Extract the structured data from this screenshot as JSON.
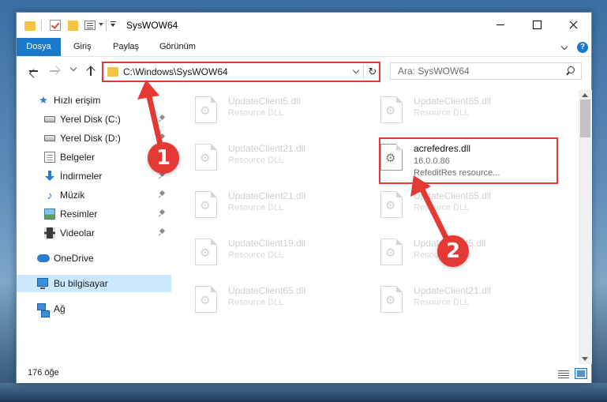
{
  "window": {
    "title": "SysWOW64"
  },
  "ribbon": {
    "tabs": [
      "Dosya",
      "Giriş",
      "Paylaş",
      "Görünüm"
    ],
    "help_icon": "?"
  },
  "nav": {
    "address": "C:\\Windows\\SysWOW64",
    "search_placeholder": "Ara: SysWOW64"
  },
  "sidebar": {
    "items": [
      {
        "label": "Hızlı erişim",
        "icon": "star-icon"
      },
      {
        "label": "Yerel Disk (C:)",
        "icon": "disk-icon",
        "pinned": true
      },
      {
        "label": "Yerel Disk (D:)",
        "icon": "disk-icon",
        "pinned": true
      },
      {
        "label": "Belgeler",
        "icon": "documents-icon",
        "pinned": true
      },
      {
        "label": "İndirmeler",
        "icon": "download-icon",
        "pinned": true
      },
      {
        "label": "Müzik",
        "icon": "music-icon",
        "pinned": true
      },
      {
        "label": "Resimler",
        "icon": "pictures-icon",
        "pinned": true
      },
      {
        "label": "Videolar",
        "icon": "videos-icon",
        "pinned": true
      },
      {
        "label": "OneDrive",
        "icon": "cloud-icon"
      },
      {
        "label": "Bu bilgisayar",
        "icon": "computer-icon",
        "selected": true
      },
      {
        "label": "Ağ",
        "icon": "network-icon"
      }
    ]
  },
  "files": {
    "left": [
      {
        "name": "UpdateClient5.dll",
        "type": "Resource DLL"
      },
      {
        "name": "UpdateClient21.dll",
        "type": "Resource DLL"
      },
      {
        "name": "UpdateClient21.dll",
        "type": "Resource DLL"
      },
      {
        "name": "UpdateClient19.dll",
        "type": "Resource DLL"
      },
      {
        "name": "UpdateClient65.dll",
        "type": "Resource DLL"
      }
    ],
    "right": [
      {
        "name": "UpdateClient65.dll",
        "type": "Resource DLL"
      },
      {
        "name": "acrefedres.dll",
        "type": "16.0.0.86",
        "desc": "RefeditRes resource...",
        "highlighted": true
      },
      {
        "name": "UpdateClient65.dll",
        "type": "Resource DLL"
      },
      {
        "name": "UpdateClient5.dll",
        "type": "Resource DLL"
      },
      {
        "name": "UpdateClient21.dll",
        "type": "Resource DLL"
      }
    ]
  },
  "status": {
    "count": "176 öğe"
  },
  "annotations": {
    "badge1": "1",
    "badge2": "2",
    "color": "#e53935"
  },
  "colors": {
    "accent": "#1979ca",
    "selection": "#cce8ff",
    "highlight_red": "#e53935"
  }
}
